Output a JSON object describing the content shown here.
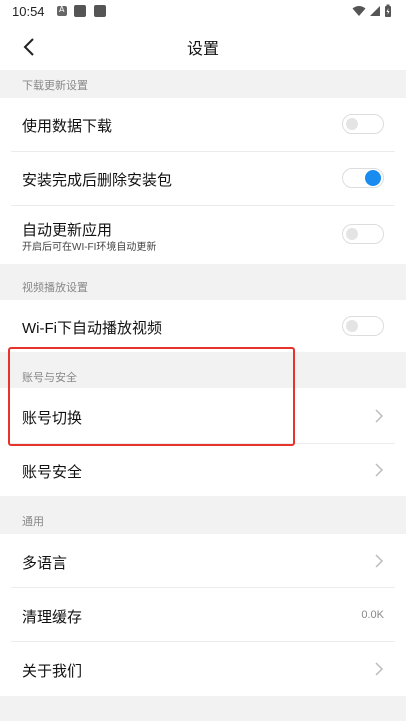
{
  "status_bar": {
    "time": "10:54"
  },
  "nav": {
    "title": "设置"
  },
  "sections": [
    {
      "header": "下载更新设置",
      "items": [
        {
          "label": "使用数据下载",
          "toggle_on": false
        },
        {
          "label": "安装完成后删除安装包",
          "toggle_on": true
        },
        {
          "label": "自动更新应用",
          "subtitle": "开启后可在WI-FI环境自动更新",
          "toggle_on": false
        }
      ]
    },
    {
      "header": "视频播放设置",
      "items": [
        {
          "label": "Wi-Fi下自动播放视频",
          "toggle_on": false
        }
      ]
    },
    {
      "header": "账号与安全",
      "items": [
        {
          "label": "账号切换"
        },
        {
          "label": "账号安全"
        }
      ]
    },
    {
      "header": "通用",
      "items": [
        {
          "label": "多语言"
        },
        {
          "label": "清理缓存",
          "value": "0.0K"
        },
        {
          "label": "关于我们"
        }
      ]
    }
  ],
  "colors": {
    "accent": "#1a8cf0",
    "highlight": "#e8322c"
  }
}
